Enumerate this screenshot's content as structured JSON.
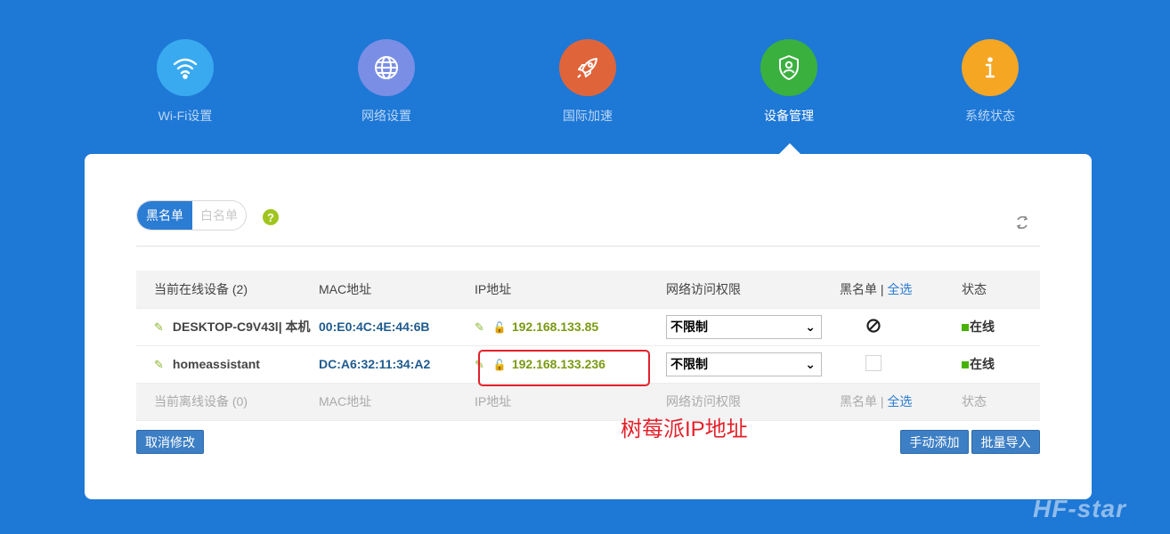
{
  "nav": [
    {
      "label": "Wi-Fi设置",
      "icon": "wifi-icon",
      "color": "#3aaaf0",
      "active": false
    },
    {
      "label": "网络设置",
      "icon": "globe-icon",
      "color": "#7a8ee6",
      "active": false
    },
    {
      "label": "国际加速",
      "icon": "rocket-icon",
      "color": "#e0643a",
      "active": false
    },
    {
      "label": "设备管理",
      "icon": "shield-user-icon",
      "color": "#3ab03e",
      "active": true
    },
    {
      "label": "系统状态",
      "icon": "info-icon",
      "color": "#f5a623",
      "active": false
    }
  ],
  "toggle": {
    "blacklist": "黑名单",
    "whitelist": "白名单"
  },
  "help_label": "?",
  "table": {
    "online_header": {
      "device": "当前在线设备 (2)",
      "mac": "MAC地址",
      "ip": "IP地址",
      "access": "网络访问权限",
      "blacklist": "黑名单",
      "sep": "|",
      "select_all": "全选",
      "status": "状态"
    },
    "rows": [
      {
        "device": "DESKTOP-C9V43l",
        "local_tag": "| 本机",
        "mac": "00:E0:4C:4E:44:6B",
        "ip_prefix": "192.168.133.",
        "ip_last": "85",
        "access": "不限制",
        "status": "在线"
      },
      {
        "device": "homeassistant",
        "local_tag": "",
        "mac": "DC:A6:32:11:34:A2",
        "ip_prefix": "192.168.133.",
        "ip_last": "236",
        "access": "不限制",
        "status": "在线"
      }
    ],
    "offline_header": {
      "device": "当前离线设备 (0)",
      "mac": "MAC地址",
      "ip": "IP地址",
      "access": "网络访问权限",
      "blacklist": "黑名单",
      "sep": "|",
      "select_all": "全选",
      "status": "状态"
    }
  },
  "buttons": {
    "cancel": "取消修改",
    "manual_add": "手动添加",
    "batch_import": "批量导入"
  },
  "annotation": "树莓派IP地址",
  "watermark": "HF-star",
  "colors": {
    "background": "#1e78d6",
    "accent": "#2b7cd3",
    "annotation": "#e3212a",
    "online": "#47b300"
  }
}
